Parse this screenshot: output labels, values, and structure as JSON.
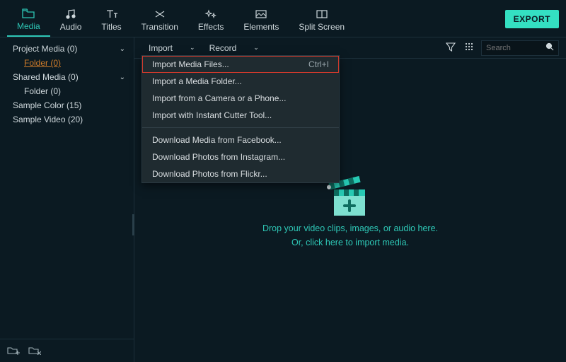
{
  "topbar": {
    "tabs": [
      {
        "label": "Media"
      },
      {
        "label": "Audio"
      },
      {
        "label": "Titles"
      },
      {
        "label": "Transition"
      },
      {
        "label": "Effects"
      },
      {
        "label": "Elements"
      },
      {
        "label": "Split Screen"
      }
    ],
    "export_label": "EXPORT"
  },
  "sidebar": {
    "items": [
      {
        "label": "Project Media (0)",
        "expandable": true,
        "selected": false
      },
      {
        "label": "Folder (0)",
        "child": true,
        "selected": true
      },
      {
        "label": "Shared Media (0)",
        "expandable": true
      },
      {
        "label": "Folder (0)",
        "child": true
      },
      {
        "label": "Sample Color (15)"
      },
      {
        "label": "Sample Video (20)"
      }
    ]
  },
  "subbar": {
    "import_label": "Import",
    "record_label": "Record",
    "search_placeholder": "Search"
  },
  "menu": {
    "items": [
      {
        "label": "Import Media Files...",
        "shortcut": "Ctrl+I",
        "highlight": true
      },
      {
        "label": "Import a Media Folder..."
      },
      {
        "label": "Import from a Camera or a Phone..."
      },
      {
        "label": "Import with Instant Cutter Tool..."
      },
      {
        "sep": true
      },
      {
        "label": "Download Media from Facebook..."
      },
      {
        "label": "Download Photos from Instagram..."
      },
      {
        "label": "Download Photos from Flickr..."
      }
    ]
  },
  "drop": {
    "line1": "Drop your video clips, images, or audio here.",
    "line2": "Or, click here to import media."
  }
}
